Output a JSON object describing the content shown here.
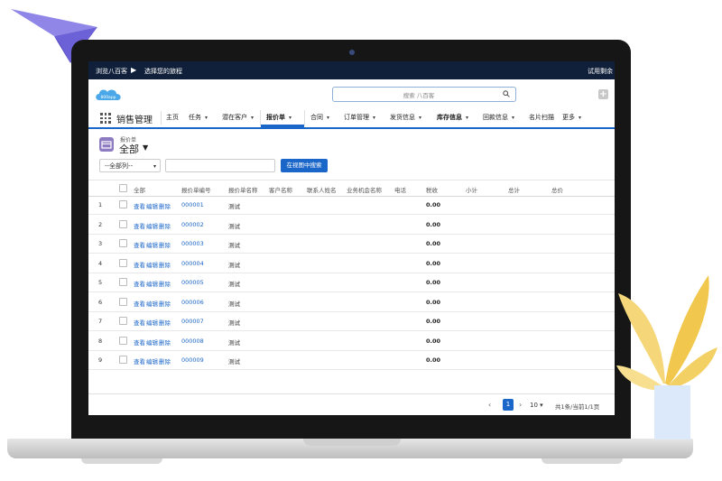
{
  "topbar": {
    "crumb1": "浏览八百客",
    "crumb2": "选择您的旅程",
    "trial": "试用剩余"
  },
  "header": {
    "logo": "800app",
    "search_placeholder": "搜索 八百客"
  },
  "nav": {
    "app_name": "销售管理",
    "items": [
      {
        "label": "主页",
        "chev": ""
      },
      {
        "label": "任务",
        "chev": "▾"
      },
      {
        "label": "潜在客户",
        "chev": "▾"
      },
      {
        "label": "报价单",
        "chev": "▾"
      },
      {
        "label": "合同",
        "chev": "▾"
      },
      {
        "label": "订单管理",
        "chev": "▾"
      },
      {
        "label": "发货信息",
        "chev": "▾"
      },
      {
        "label": "库存信息",
        "chev": "▾"
      },
      {
        "label": "回款信息",
        "chev": "▾"
      },
      {
        "label": "名片扫描",
        "chev": ""
      },
      {
        "label": "更多",
        "chev": "▾"
      }
    ]
  },
  "list": {
    "object_label": "报价单",
    "view_name": "全部",
    "filter_select": "--全部列--",
    "filter_button": "在视图中搜索"
  },
  "table": {
    "columns": [
      "全部",
      "报价单编号",
      "报价单名称",
      "客户名称",
      "联系人姓名",
      "业务机会名称",
      "电话",
      "税收",
      "小计",
      "总计",
      "总价"
    ],
    "action_view": "查看",
    "action_edit": "编辑",
    "action_delete": "删除",
    "rows": [
      {
        "n": "1",
        "id": "000001",
        "name": "测试",
        "tax": "0.00"
      },
      {
        "n": "2",
        "id": "000002",
        "name": "测试",
        "tax": "0.00"
      },
      {
        "n": "3",
        "id": "000003",
        "name": "测试",
        "tax": "0.00"
      },
      {
        "n": "4",
        "id": "000004",
        "name": "测试",
        "tax": "0.00"
      },
      {
        "n": "5",
        "id": "000005",
        "name": "测试",
        "tax": "0.00"
      },
      {
        "n": "6",
        "id": "000006",
        "name": "测试",
        "tax": "0.00"
      },
      {
        "n": "7",
        "id": "000007",
        "name": "测试",
        "tax": "0.00"
      },
      {
        "n": "8",
        "id": "000008",
        "name": "测试",
        "tax": "0.00"
      },
      {
        "n": "9",
        "id": "000009",
        "name": "测试",
        "tax": "0.00"
      }
    ]
  },
  "pagination": {
    "prev": "‹",
    "current": "1",
    "next": "›",
    "page_size": "10",
    "info": "共1条/当前1/1页"
  },
  "colors": {
    "nav_accent": "#1b66c9",
    "topbar": "#10203a",
    "object_icon": "#8e7cc3"
  }
}
